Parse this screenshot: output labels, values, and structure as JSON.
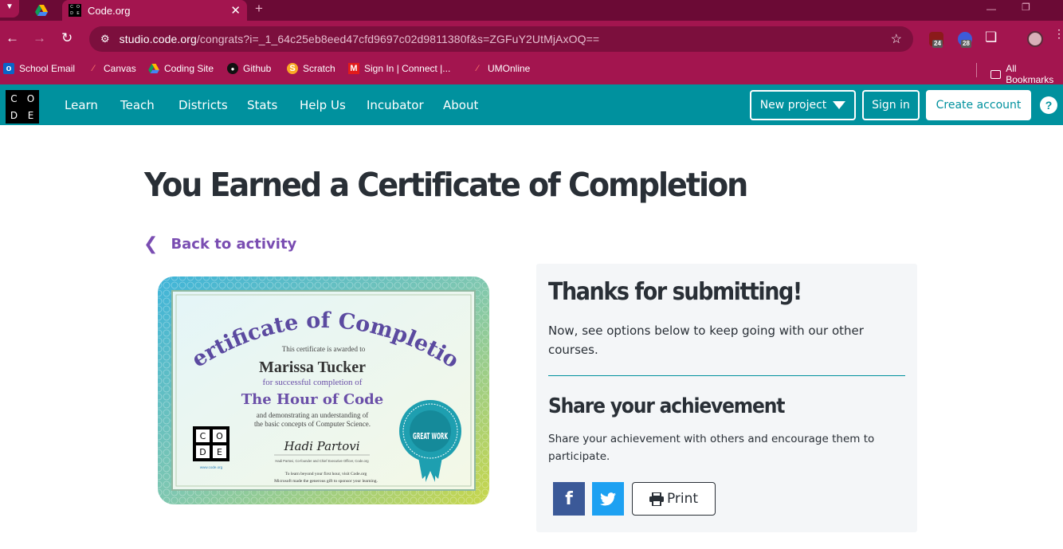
{
  "browser": {
    "tab_title": "Code.org",
    "url_host": "studio.code.org",
    "url_path": "/congrats?i=_1_64c25eb8eed47cfd9697c02d9811380f&s=ZGFuY2UtMjAxOQ==",
    "extension_badges": [
      "24",
      "28"
    ],
    "bookmarks": [
      {
        "label": "School Email",
        "icon": "outlook-icon"
      },
      {
        "label": "Canvas",
        "icon": "canvas-icon"
      },
      {
        "label": "Coding Site",
        "icon": "drive-icon"
      },
      {
        "label": "Github",
        "icon": "github-icon"
      },
      {
        "label": "Scratch",
        "icon": "scratch-icon"
      },
      {
        "label": "Sign In | Connect |...",
        "icon": "mcgraw-icon"
      },
      {
        "label": "UMOnline",
        "icon": "canvas-icon"
      }
    ],
    "all_bookmarks": "All Bookmarks"
  },
  "header": {
    "logo_letters": [
      "C",
      "O",
      "D",
      "E"
    ],
    "nav": [
      "Learn",
      "Teach",
      "Districts",
      "Stats",
      "Help Us",
      "Incubator",
      "About"
    ],
    "new_project": "New project",
    "sign_in": "Sign in",
    "create_account": "Create account",
    "help": "?"
  },
  "main": {
    "title": "You Earned a Certificate of Completion",
    "back_link": "Back to activity",
    "certificate": {
      "heading": "Certificate of Completion",
      "awarded": "This certificate is awarded to",
      "name": "Marissa Tucker",
      "for_completion": "for successful completion of",
      "course": "The Hour of Code",
      "demonstrating": "and demonstrating an understanding of",
      "concepts": "the basic concepts of Computer Science.",
      "signature": "Hadi Partovi",
      "signer": "Hadi Partovi, Co-founder and Chief Executive Officer, Code.org",
      "learn_beyond": "To learn beyond your first hour, visit Code.org",
      "sponsor": "Microsoft made the generous gift to sponsor your learning.",
      "site": "www.code.org",
      "badge": "GREAT WORK",
      "logo_letters": [
        "C",
        "O",
        "D",
        "E"
      ]
    },
    "panel": {
      "thanks": "Thanks for submitting!",
      "thanks_desc": "Now, see options below to keep going with our other courses.",
      "share_title": "Share your achievement",
      "share_desc": "Share your achievement with others and encourage them to participate.",
      "facebook": "f",
      "print": "Print"
    }
  },
  "colors": {
    "browser_bg": "#a3154f",
    "header_teal": "#00919e",
    "link_purple": "#7a4db2",
    "text_dark": "#292f36",
    "facebook": "#3b5998",
    "twitter": "#1da1f2"
  }
}
